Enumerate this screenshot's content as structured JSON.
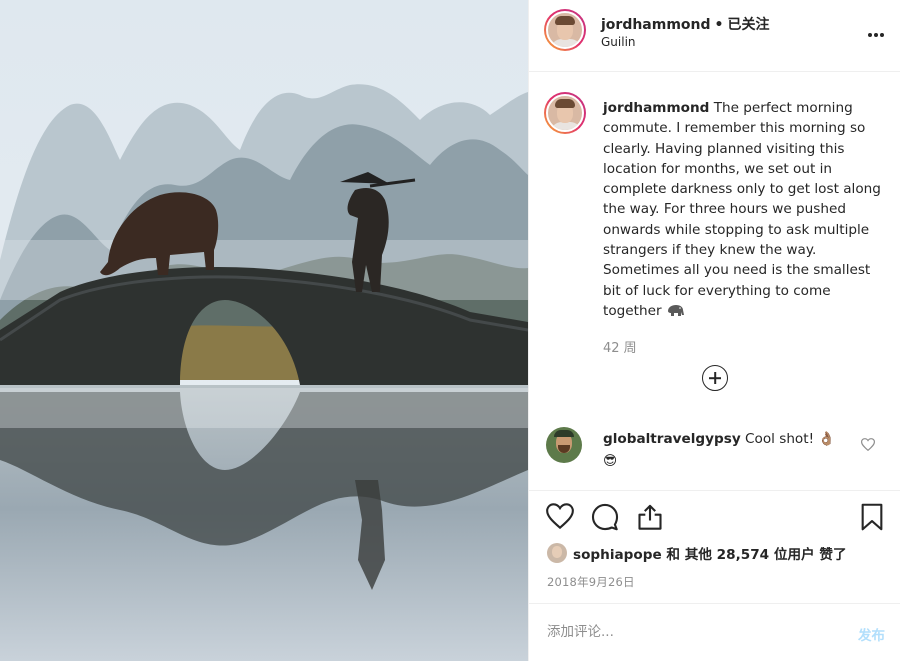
{
  "post": {
    "username": "jordhammond",
    "follow_status": "已关注",
    "separator": "•",
    "location": "Guilin"
  },
  "caption": {
    "username": "jordhammond",
    "text": "The perfect morning commute. I remember this morning so clearly. Having planned visiting this location for months, we set out in complete darkness only to get lost along the way. For three hours we pushed onwards while stopping to ask multiple strangers if they knew the way. Sometimes all you need is the smallest bit of luck for everything to come together",
    "emoji_icon": "elephant-icon",
    "age": "42 周"
  },
  "comments": [
    {
      "username": "globaltravelgypsy",
      "text": "Cool shot! 👌🏽",
      "emoji": "😎"
    }
  ],
  "likes": {
    "text": "sophiapope 和 其他 28,574 位用户 赞了"
  },
  "date": "2018年9月26日",
  "composer": {
    "placeholder": "添加评论...",
    "post_label": "发布"
  },
  "icons": {
    "more": "more-options-icon",
    "load_more": "plus-circle-icon",
    "like": "heart-icon",
    "comment": "comment-bubble-icon",
    "share": "share-icon",
    "save": "bookmark-icon"
  },
  "colors": {
    "text": "#262626",
    "muted": "#8e8e8e",
    "post_button_disabled": "#b2dffc",
    "divider": "#efefef"
  }
}
